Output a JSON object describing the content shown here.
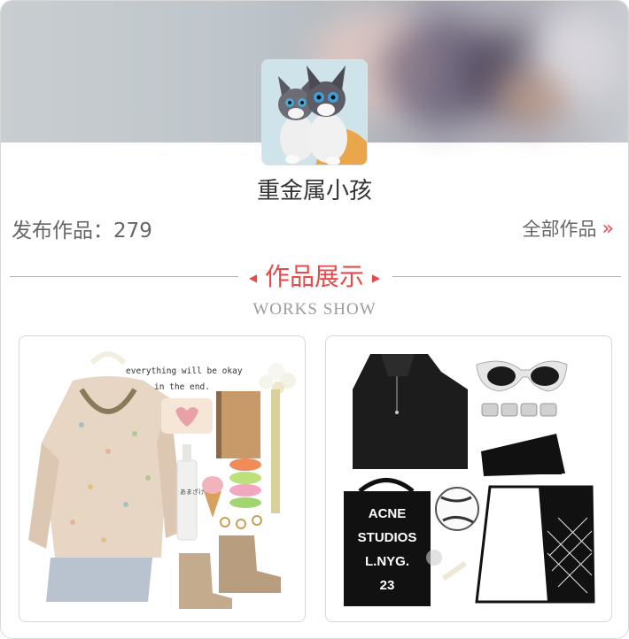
{
  "profile": {
    "username": "重金属小孩",
    "published_label": "发布作品：279",
    "all_works_label": "全部作品",
    "all_works_chevron": "»"
  },
  "section": {
    "title": "作品展示",
    "subtitle": "WORKS SHOW"
  },
  "works": [
    {
      "note_line1": "everything will be okay",
      "note_line2": "in the end.",
      "bottle_text": "あまざけ"
    },
    {
      "bag_lines": [
        "ACNE",
        "STUDIOS",
        "L.NYG.",
        "23"
      ]
    }
  ],
  "icons": {
    "chevron": "double-chevron-right-icon",
    "triangles": "triangle-left-right-icon"
  },
  "colors": {
    "accent": "#e64b4b",
    "text": "#333333",
    "muted": "#666666"
  }
}
